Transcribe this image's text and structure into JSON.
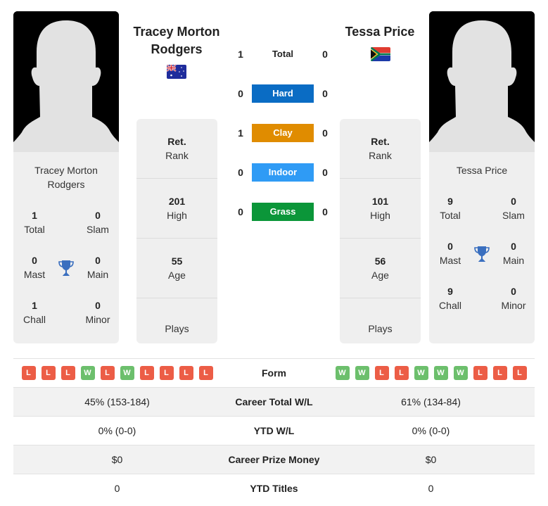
{
  "player1": {
    "name_header": "Tracey Morton Rodgers",
    "name_header_line1": "Tracey Morton",
    "name_header_line2": "Rodgers",
    "card_name_line1": "Tracey Morton",
    "card_name_line2": "Rodgers",
    "flag": "australia-flag",
    "titles": {
      "total": {
        "value": "1",
        "label": "Total"
      },
      "slam": {
        "value": "0",
        "label": "Slam"
      },
      "mast": {
        "value": "0",
        "label": "Mast"
      },
      "main": {
        "value": "0",
        "label": "Main"
      },
      "chall": {
        "value": "1",
        "label": "Chall"
      },
      "minor": {
        "value": "0",
        "label": "Minor"
      }
    },
    "info": {
      "rank": {
        "value": "Ret.",
        "label": "Rank"
      },
      "high": {
        "value": "201",
        "label": "High"
      },
      "age": {
        "value": "55",
        "label": "Age"
      },
      "plays": {
        "value": "",
        "label": "Plays"
      }
    },
    "form": [
      "L",
      "L",
      "L",
      "W",
      "L",
      "W",
      "L",
      "L",
      "L",
      "L"
    ],
    "career_total_wl": "45% (153-184)",
    "ytd_wl": "0% (0-0)",
    "career_prize_money": "$0",
    "ytd_titles": "0"
  },
  "player2": {
    "name_header": "Tessa Price",
    "card_name": "Tessa Price",
    "flag": "south-africa-flag",
    "titles": {
      "total": {
        "value": "9",
        "label": "Total"
      },
      "slam": {
        "value": "0",
        "label": "Slam"
      },
      "mast": {
        "value": "0",
        "label": "Mast"
      },
      "main": {
        "value": "0",
        "label": "Main"
      },
      "chall": {
        "value": "9",
        "label": "Chall"
      },
      "minor": {
        "value": "0",
        "label": "Minor"
      }
    },
    "info": {
      "rank": {
        "value": "Ret.",
        "label": "Rank"
      },
      "high": {
        "value": "101",
        "label": "High"
      },
      "age": {
        "value": "56",
        "label": "Age"
      },
      "plays": {
        "value": "",
        "label": "Plays"
      }
    },
    "form": [
      "W",
      "W",
      "L",
      "L",
      "W",
      "W",
      "W",
      "L",
      "L",
      "L"
    ],
    "career_total_wl": "61% (134-84)",
    "ytd_wl": "0% (0-0)",
    "career_prize_money": "$0",
    "ytd_titles": "0"
  },
  "h2h": [
    {
      "label": "Total",
      "left": "1",
      "right": "0",
      "color": ""
    },
    {
      "label": "Hard",
      "left": "0",
      "right": "0",
      "color": "#0a6cc4"
    },
    {
      "label": "Clay",
      "left": "1",
      "right": "0",
      "color": "#e08c00"
    },
    {
      "label": "Indoor",
      "left": "0",
      "right": "0",
      "color": "#2f9bf5"
    },
    {
      "label": "Grass",
      "left": "0",
      "right": "0",
      "color": "#0b9639"
    }
  ],
  "stats_labels": {
    "form": "Form",
    "career_total_wl": "Career Total W/L",
    "ytd_wl": "YTD W/L",
    "career_prize_money": "Career Prize Money",
    "ytd_titles": "YTD Titles"
  },
  "colors": {
    "win": "#6cbf6c",
    "loss": "#ec5d46",
    "trophy": "#3a6fbf"
  }
}
